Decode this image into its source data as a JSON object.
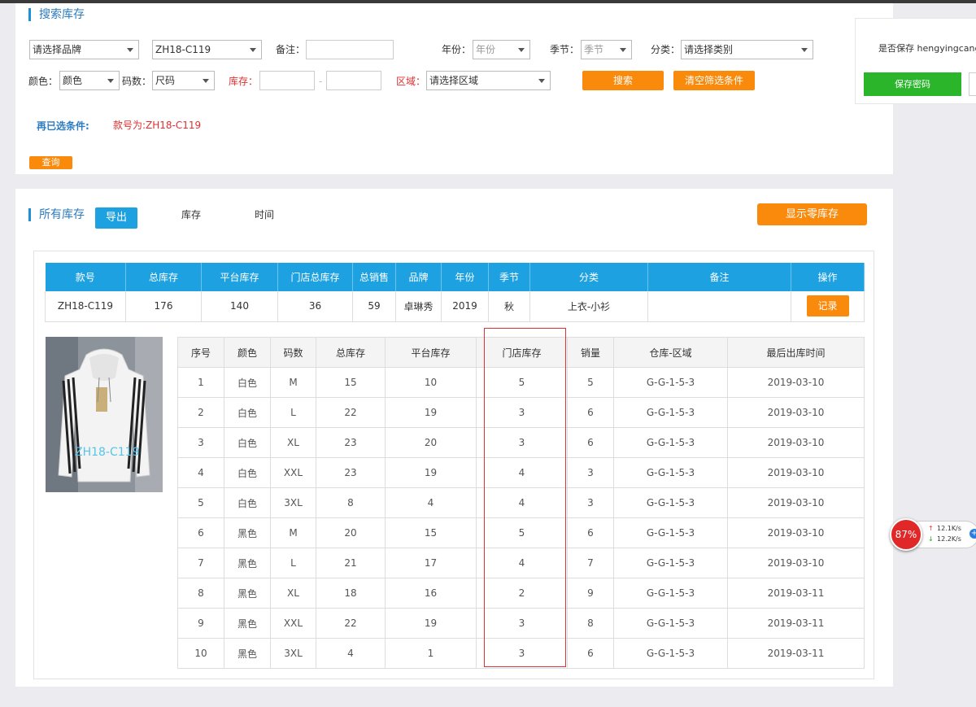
{
  "search": {
    "title": "搜索库存",
    "brand_placeholder": "请选择品牌",
    "style_value": "ZH18-C119",
    "remark_label": "备注：",
    "year_label": "年份：",
    "year_value": "年份",
    "season_label": "季节：",
    "season_value": "季节",
    "category_label": "分类：",
    "category_value": "请选择类别",
    "color_label": "颜色：",
    "color_value": "颜色",
    "size_label": "码数：",
    "size_value": "尺码",
    "stock_label": "库存：",
    "range_dash": "-",
    "region_label": "区域：",
    "region_value": "请选择区域",
    "search_btn": "搜索",
    "clear_btn": "清空筛选条件",
    "selected_label": "再已选条件:",
    "selected_value": "款号为:ZH18-C119",
    "query_btn": "查询"
  },
  "side": {
    "save_text": "是否保存 hengyingcang",
    "save_btn": "保存密码"
  },
  "inventory": {
    "title": "所有库存",
    "export_btn": "导出",
    "tab_stock": "库存",
    "tab_time": "时间",
    "show_zero_btn": "显示零库存"
  },
  "summary": {
    "headers": [
      "款号",
      "总库存",
      "平台库存",
      "门店总库存",
      "总销售",
      "品牌",
      "年份",
      "季节",
      "分类",
      "备注",
      "操作"
    ],
    "row": [
      "ZH18-C119",
      "176",
      "140",
      "36",
      "59",
      "卓琳秀",
      "2019",
      "秋",
      "上衣-小衫",
      ""
    ],
    "record_btn": "记录"
  },
  "photo_caption": "ZH18-C119",
  "detail": {
    "headers": [
      "序号",
      "颜色",
      "码数",
      "总库存",
      "平台库存",
      "门店库存",
      "销量",
      "仓库-区域",
      "最后出库时间"
    ],
    "rows": [
      [
        "1",
        "白色",
        "M",
        "15",
        "10",
        "5",
        "5",
        "G-G-1-5-3",
        "2019-03-10"
      ],
      [
        "2",
        "白色",
        "L",
        "22",
        "19",
        "3",
        "6",
        "G-G-1-5-3",
        "2019-03-10"
      ],
      [
        "3",
        "白色",
        "XL",
        "23",
        "20",
        "3",
        "6",
        "G-G-1-5-3",
        "2019-03-10"
      ],
      [
        "4",
        "白色",
        "XXL",
        "23",
        "19",
        "4",
        "3",
        "G-G-1-5-3",
        "2019-03-10"
      ],
      [
        "5",
        "白色",
        "3XL",
        "8",
        "4",
        "4",
        "3",
        "G-G-1-5-3",
        "2019-03-10"
      ],
      [
        "6",
        "黑色",
        "M",
        "20",
        "15",
        "5",
        "6",
        "G-G-1-5-3",
        "2019-03-10"
      ],
      [
        "7",
        "黑色",
        "L",
        "21",
        "17",
        "4",
        "7",
        "G-G-1-5-3",
        "2019-03-10"
      ],
      [
        "8",
        "黑色",
        "XL",
        "18",
        "16",
        "2",
        "9",
        "G-G-1-5-3",
        "2019-03-11"
      ],
      [
        "9",
        "黑色",
        "XXL",
        "22",
        "19",
        "3",
        "8",
        "G-G-1-5-3",
        "2019-03-11"
      ],
      [
        "10",
        "黑色",
        "3XL",
        "4",
        "1",
        "3",
        "6",
        "G-G-1-5-3",
        "2019-03-11"
      ]
    ]
  },
  "network": {
    "cpu": "87%",
    "up": "12.1K/s",
    "down": "12.2K/s"
  },
  "colors": {
    "accent": "#1ea1e0",
    "orange": "#fa8a0c",
    "green": "#2ab52a",
    "highlight": "#d33"
  }
}
